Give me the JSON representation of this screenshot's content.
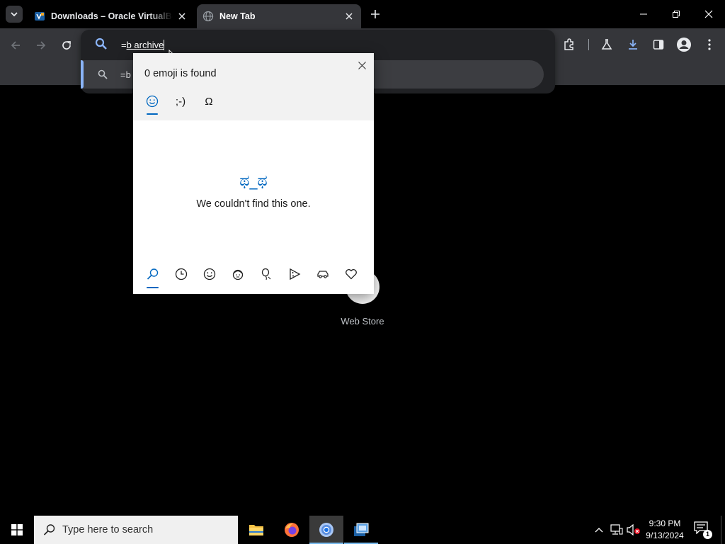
{
  "browser": {
    "tabs": [
      {
        "title": "Downloads – Oracle VirtualBox",
        "icon": "virtualbox-icon",
        "active": false
      },
      {
        "title": "New Tab",
        "icon": "globe-icon",
        "active": true
      }
    ],
    "omnibox": {
      "prefix": "=",
      "typed": "b archive",
      "suggestion_text": "=b"
    },
    "accent_color": "#8ab4f8"
  },
  "page": {
    "shortcut_label": "Web Store"
  },
  "emoji_panel": {
    "result_count": "0 emoji is found",
    "tabs": [
      {
        "name": "emoji",
        "glyph": "☺"
      },
      {
        "name": "kaomoji",
        "glyph": ";-)"
      },
      {
        "name": "symbols",
        "glyph": "Ω"
      }
    ],
    "empty_kaomoji": "ಥ_ಥ",
    "empty_message": "We couldn't find this one.",
    "categories": [
      "search",
      "recent",
      "smiley",
      "people",
      "celebration",
      "food",
      "travel",
      "heart"
    ],
    "accent_color": "#0067c0"
  },
  "taskbar": {
    "search_placeholder": "Type here to search",
    "clock_time": "9:30 PM",
    "clock_date": "9/13/2024",
    "notification_count": "1",
    "apps": [
      "file-explorer",
      "firefox",
      "chrome",
      "virtualbox"
    ]
  }
}
